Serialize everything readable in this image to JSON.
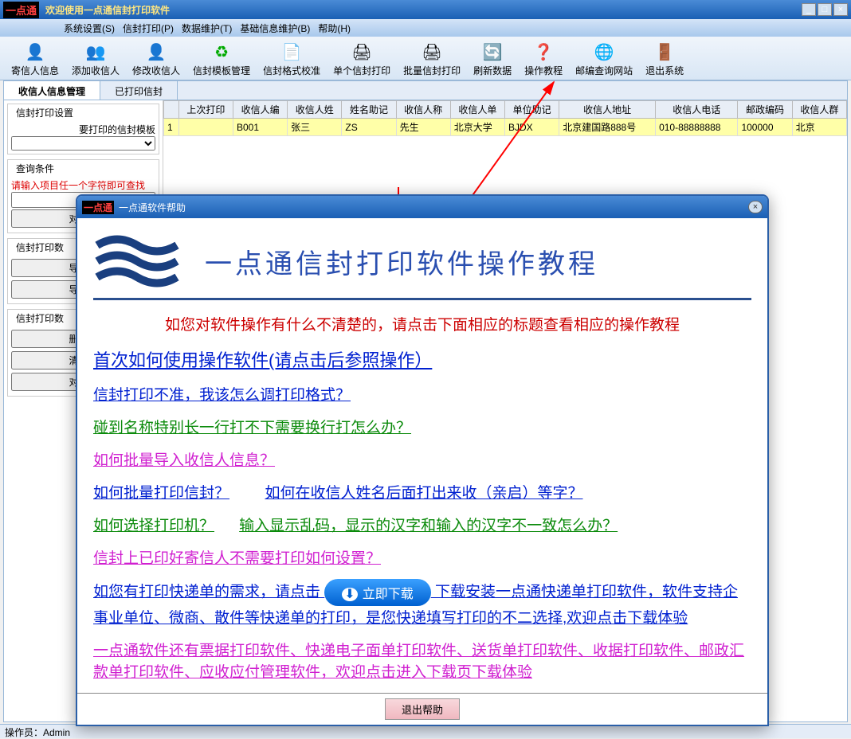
{
  "app": {
    "logo": "一点通",
    "title": "欢迎使用一点通信封打印软件"
  },
  "menus": [
    "系统设置(S)",
    "信封打印(P)",
    "数据维护(T)",
    "基础信息维护(B)",
    "帮助(H)"
  ],
  "toolbar": [
    {
      "label": "寄信人信息",
      "icon": "ico-user"
    },
    {
      "label": "添加收信人",
      "icon": "ico-add"
    },
    {
      "label": "修改收信人",
      "icon": "ico-edit"
    },
    {
      "label": "信封模板管理",
      "icon": "ico-recy"
    },
    {
      "label": "信封格式校准",
      "icon": "ico-doc"
    },
    {
      "label": "单个信封打印",
      "icon": "ico-p1"
    },
    {
      "label": "批量信封打印",
      "icon": "ico-pn"
    },
    {
      "label": "刷新数据",
      "icon": "ico-ref"
    },
    {
      "label": "操作教程",
      "icon": "ico-help"
    },
    {
      "label": "邮编查询网站",
      "icon": "ico-ie"
    },
    {
      "label": "退出系统",
      "icon": "ico-exit"
    }
  ],
  "tabs": {
    "active": "收信人信息管理",
    "inactive": "已打印信封"
  },
  "left": {
    "group1_title": "信封打印设置",
    "template_label": "要打印的信封模板",
    "group2_title": "查询条件",
    "query_hint": "请输入项目任一个字符即可查找",
    "btn_query": "对查询",
    "group3_title": "信封打印数",
    "btn_import": "导入收",
    "btn_export": "导出查",
    "group4_title": "信封打印数",
    "btn_delall": "删除所",
    "btn_clear": "清空收",
    "btn_sortmail": "对邮编"
  },
  "grid": {
    "cols": [
      "",
      "上次打印",
      "收信人编",
      "收信人姓",
      "姓名助记",
      "收信人称",
      "收信人单",
      "单位助记",
      "收信人地址",
      "收信人电话",
      "邮政编码",
      "收信人群"
    ],
    "row": [
      "1",
      "",
      "B001",
      "张三",
      "ZS",
      "先生",
      "北京大学",
      "BJDX",
      "北京建国路888号",
      "010-88888888",
      "100000",
      "北京"
    ]
  },
  "status": "操作员：Admin",
  "dialog": {
    "logo": "一点通",
    "title": "一点通软件帮助",
    "heading": "一点通信封打印软件操作教程",
    "intro": "如您对软件操作有什么不清楚的，请点击下面相应的标题查看相应的操作教程",
    "link_first": "首次如何使用操作软件(请点击后参照操作）",
    "link_inacc": "信封打印不准，我该怎么调打印格式？",
    "link_long": "碰到名称特别长一行打不下需要换行打怎么办？",
    "link_import": "如何批量导入收信人信息？",
    "link_batch": "如何批量打印信封？",
    "link_suffix": "如何在收信人姓名后面打出来收（亲启）等字？",
    "link_printer": "如何选择打印机？",
    "link_garble": "输入显示乱码，显示的汉字和输入的汉字不一致怎么办？",
    "link_preprint": "信封上已印好寄信人不需要打印如何设置？",
    "dl_pre": "如您有打印快递单的需求，请点击",
    "dl_btn": "立即下载",
    "dl_post": "下载安装一点通快递单打印软件，软件支持企事业单位、微商、散件等快递单的打印，是您快递填写打印的不二选择,欢迎点击下载体验",
    "link_more": "一点通软件还有票据打印软件、快递电子面单打印软件、送货单打印软件、收据打印软件、邮政汇款单打印软件、应收应付管理软件，欢迎点击进入下载页下载体验",
    "exit_btn": "退出帮助"
  }
}
